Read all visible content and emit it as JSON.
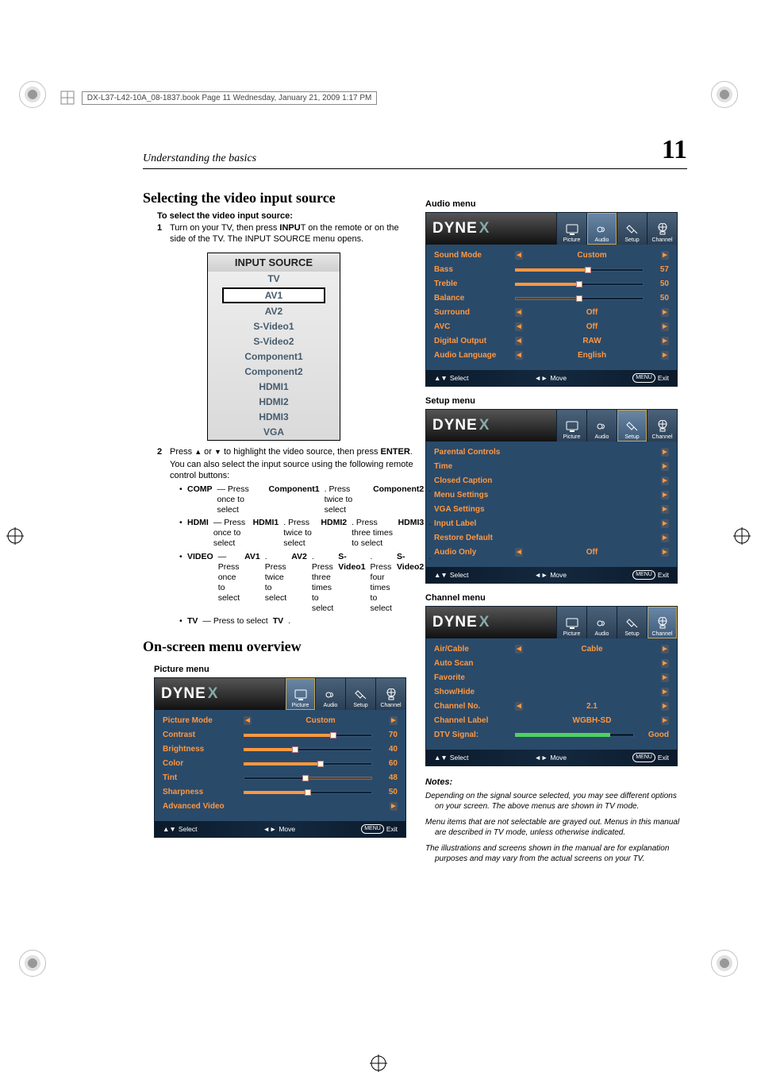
{
  "bookline": "DX-L37-L42-10A_08-1837.book  Page 11  Wednesday, January 21, 2009  1:17 PM",
  "running_head": {
    "left": "Understanding the basics",
    "page": "11"
  },
  "left_col": {
    "select_title": "Selecting the video input source",
    "to_select": "To select the video input source:",
    "step1": "Turn on your TV, then press INPUT on the remote or on the side of the TV. The INPUT SOURCE menu opens.",
    "step1_pre": "Turn on your TV, then press ",
    "step1_bold": "INPU",
    "step1_tail": "T on the remote or on the side of the TV. The INPUT SOURCE menu opens.",
    "input_source": {
      "title": "INPUT SOURCE",
      "items": [
        "TV",
        "AV1",
        "AV2",
        "S-Video1",
        "S-Video2",
        "Component1",
        "Component2",
        "HDMI1",
        "HDMI2",
        "HDMI3",
        "VGA"
      ],
      "selected_index": 1
    },
    "step2_line1_pre": "Press ",
    "step2_line1_mid": " or ",
    "step2_line1_mid2": " to highlight the video source, then press ",
    "step2_line1_bold": "ENTER",
    "step2_line1_end": ".",
    "step2_line2": "You can also select the input source using the following remote control buttons:",
    "bullets": {
      "comp": {
        "lead": "COMP",
        "rest": "— Press once to select ",
        "b1": "Component1",
        "rest2": ". Press twice to select ",
        "b2": "Component2",
        "end": "."
      },
      "hdmi": {
        "lead": "HDMI",
        "rest": "— Press once to select ",
        "b1": "HDMI1",
        "rest2": ". Press twice to select ",
        "b2": "HDMI2",
        "rest3": ". Press three times to select ",
        "b3": "HDMI3",
        "end": "."
      },
      "video": {
        "lead": "VIDEO",
        "rest": " — Press once to select ",
        "b1": "AV1",
        "rest2": ". Press twice to select ",
        "b2": "AV2",
        "rest3": ". Press three times to select ",
        "b3": "S-Video1",
        "rest4": ". Press four times to select ",
        "b4": "S-Video2",
        "end": "."
      },
      "tv": {
        "lead": "TV",
        "rest": "— Press to select ",
        "b1": "TV",
        "end": "."
      }
    },
    "overview_title": "On-screen menu overview"
  },
  "osd": {
    "logo_a": "DYNE",
    "logo_b": "X",
    "tabs": [
      "Picture",
      "Audio",
      "Setup",
      "Channel"
    ],
    "footer": {
      "select": "Select",
      "move": "Move",
      "menu": "MENU",
      "exit": "Exit",
      "arrows_ud": "▲▼",
      "arrows_lr": "◄►"
    }
  },
  "picture_menu": {
    "title": "Picture menu",
    "rows": [
      {
        "label": "Picture Mode",
        "type": "select",
        "value": "Custom"
      },
      {
        "label": "Contrast",
        "type": "slider",
        "value": 70
      },
      {
        "label": "Brightness",
        "type": "slider",
        "value": 40
      },
      {
        "label": "Color",
        "type": "slider",
        "value": 60
      },
      {
        "label": "Tint",
        "type": "slider_center",
        "value": 48
      },
      {
        "label": "Sharpness",
        "type": "slider",
        "value": 50
      },
      {
        "label": "Advanced Video",
        "type": "nav"
      }
    ]
  },
  "audio_menu": {
    "title": "Audio menu",
    "rows": [
      {
        "label": "Sound Mode",
        "type": "select",
        "value": "Custom"
      },
      {
        "label": "Bass",
        "type": "slider",
        "value": 57
      },
      {
        "label": "Treble",
        "type": "slider",
        "value": 50
      },
      {
        "label": "Balance",
        "type": "slider_center",
        "value": 50
      },
      {
        "label": "Surround",
        "type": "select",
        "value": "Off"
      },
      {
        "label": "AVC",
        "type": "select",
        "value": "Off"
      },
      {
        "label": "Digital Output",
        "type": "select",
        "value": "RAW"
      },
      {
        "label": "Audio Language",
        "type": "select",
        "value": "English"
      }
    ]
  },
  "setup_menu": {
    "title": "Setup menu",
    "rows": [
      {
        "label": "Parental Controls",
        "type": "nav"
      },
      {
        "label": "Time",
        "type": "nav"
      },
      {
        "label": "Closed Caption",
        "type": "nav"
      },
      {
        "label": "Menu Settings",
        "type": "nav"
      },
      {
        "label": "VGA Settings",
        "type": "nav"
      },
      {
        "label": "Input Label",
        "type": "nav"
      },
      {
        "label": "Restore Default",
        "type": "nav"
      },
      {
        "label": "Audio Only",
        "type": "select",
        "value": "Off"
      }
    ]
  },
  "channel_menu": {
    "title": "Channel menu",
    "rows": [
      {
        "label": "Air/Cable",
        "type": "select",
        "value": "Cable"
      },
      {
        "label": "Auto Scan",
        "type": "nav"
      },
      {
        "label": "Favorite",
        "type": "nav"
      },
      {
        "label": "Show/Hide",
        "type": "nav"
      },
      {
        "label": "Channel No.",
        "type": "select",
        "value": "2.1"
      },
      {
        "label": "Channel Label",
        "type": "select_noleft",
        "value": "WGBH-SD"
      },
      {
        "label": "DTV Signal:",
        "type": "signal",
        "value": "Good",
        "pct": 80
      }
    ]
  },
  "notes": {
    "heading": "Notes:",
    "n1": "Depending on the signal source selected, you may see different options on your screen. The above menus are shown in TV mode.",
    "n2": "Menu items that are not selectable are grayed out. Menus in this manual are described in TV mode, unless otherwise indicated.",
    "n3": "The illustrations and screens shown in the manual are for explanation purposes and may vary from the actual screens on your TV."
  }
}
